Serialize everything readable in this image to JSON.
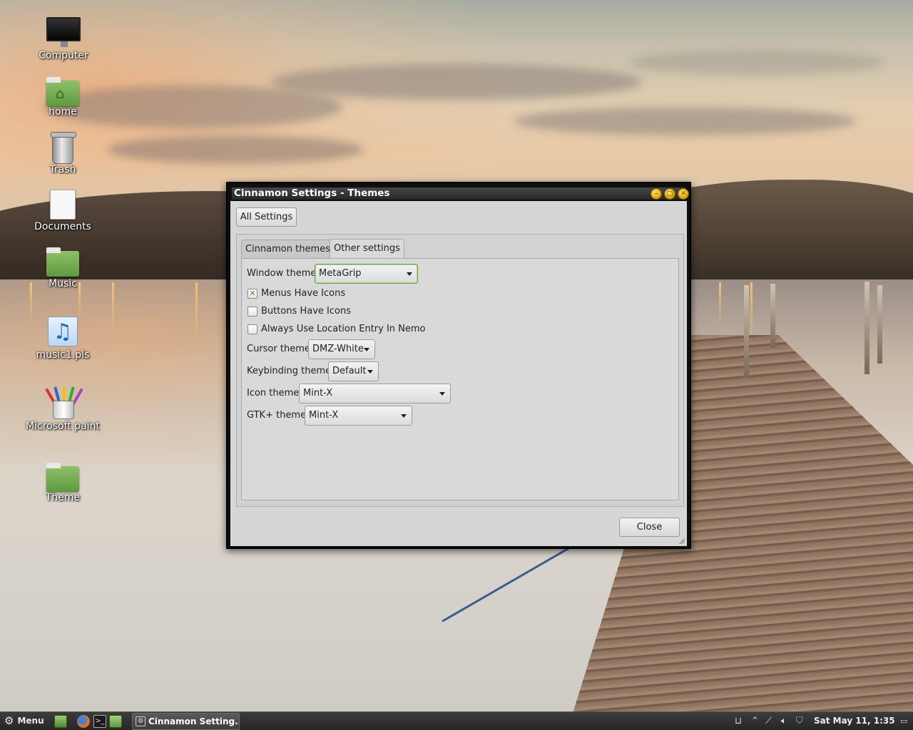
{
  "desktop": {
    "icons": [
      {
        "label": "Computer",
        "icon": "monitor-icon"
      },
      {
        "label": "home",
        "icon": "home-folder-icon"
      },
      {
        "label": "Trash",
        "icon": "trash-icon"
      },
      {
        "label": "Documents",
        "icon": "document-icon"
      },
      {
        "label": "Music",
        "icon": "folder-icon"
      },
      {
        "label": "music1.pls",
        "icon": "music-file-icon"
      },
      {
        "label": "Microsoft paint",
        "icon": "paint-icon"
      },
      {
        "label": "Theme",
        "icon": "folder-icon"
      }
    ]
  },
  "window": {
    "title": "Cinnamon Settings - Themes",
    "title_buttons": [
      "minimize",
      "maximize",
      "close"
    ],
    "all_settings_label": "All Settings",
    "tabs": [
      {
        "label": "Cinnamon themes",
        "active": false
      },
      {
        "label": "Other settings",
        "active": true
      }
    ],
    "settings": {
      "window_theme": {
        "label": "Window theme",
        "value": "MetaGrip"
      },
      "menus_have_icons": {
        "label": "Menus Have Icons",
        "checked": true
      },
      "buttons_have_icons": {
        "label": "Buttons Have Icons",
        "checked": false
      },
      "always_location_entry": {
        "label": "Always Use Location Entry In Nemo",
        "checked": false
      },
      "cursor_theme": {
        "label": "Cursor theme",
        "value": "DMZ-White"
      },
      "keybinding_theme": {
        "label": "Keybinding theme",
        "value": "Default"
      },
      "icon_theme": {
        "label": "Icon theme",
        "value": "Mint-X"
      },
      "gtk_theme": {
        "label": "GTK+ theme",
        "value": "Mint-X"
      }
    },
    "close_label": "Close"
  },
  "panel": {
    "menu_label": "Menu",
    "launchers": [
      "show-desktop-icon",
      "firefox-icon",
      "terminal-icon",
      "files-icon"
    ],
    "task_label": "Cinnamon Setting...",
    "tray_icons": [
      "window-list-icon",
      "up-arrow-icon",
      "network-icon",
      "volume-icon",
      "update-shield-icon"
    ],
    "clock": "Sat May 11,  1:35",
    "colors": {
      "accent": "#6ea84a",
      "panel_bg": "#2e2e2e"
    }
  }
}
